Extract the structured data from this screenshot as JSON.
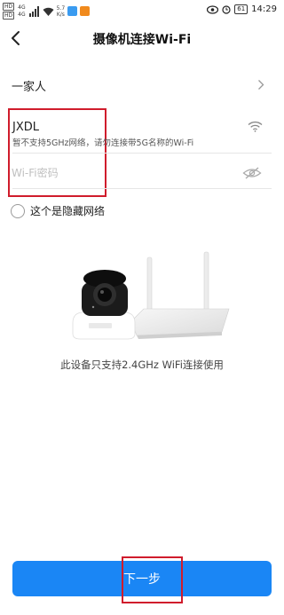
{
  "status_bar": {
    "sim1": "HD",
    "sim2": "HD",
    "net1": "4G",
    "net2": "4G",
    "speed_value": "5.7",
    "speed_unit": "K/s",
    "battery": "61",
    "time": "14:29"
  },
  "nav": {
    "title": "摄像机连接Wi-Fi"
  },
  "family": {
    "label": "一家人"
  },
  "wifi": {
    "ssid": "JXDL",
    "hint": "暂不支持5GHz网络，请勿连接带5G名称的Wi-Fi",
    "password_value": "",
    "password_placeholder": "Wi-Fi密码"
  },
  "hidden_network": {
    "label": "这个是隐藏网络"
  },
  "illustration": {
    "caption": "此设备只支持2.4GHz WiFi连接使用"
  },
  "footer": {
    "next_label": "下一步"
  },
  "colors": {
    "accent": "#1a86f5",
    "highlight": "#d01c2c"
  }
}
